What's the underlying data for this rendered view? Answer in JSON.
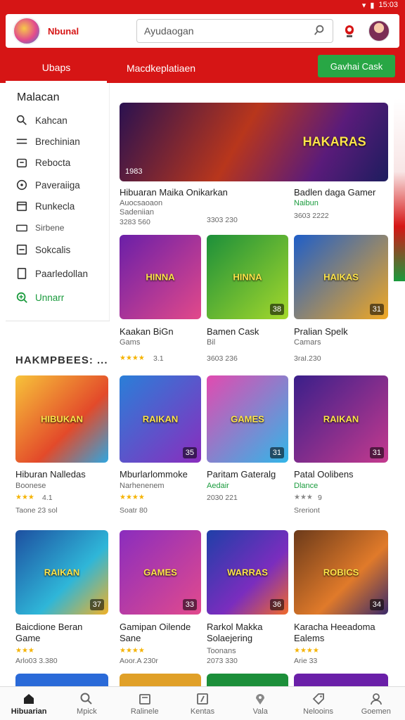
{
  "status": {
    "time": "15:03"
  },
  "header": {
    "brand": "Nbunal",
    "search_placeholder": "Ayudaogan"
  },
  "tabs": [
    {
      "label": "Ubaps"
    },
    {
      "label": "Macdkeplatiaen"
    }
  ],
  "cta": {
    "label": "Gavhai Cask"
  },
  "sidebar": {
    "title": "Malacan",
    "items": [
      {
        "label": "Kahcan",
        "icon": "search-icon"
      },
      {
        "label": "Brechinian",
        "icon": "list-icon"
      },
      {
        "label": "Rebocta",
        "icon": "bag-icon"
      },
      {
        "label": "Paveraiiga",
        "icon": "compass-icon"
      },
      {
        "label": "Runkecla",
        "icon": "folder-icon"
      },
      {
        "label": "Sirbene",
        "icon": "card-icon"
      },
      {
        "label": "Sokcalis",
        "icon": "minus-box-icon"
      },
      {
        "label": "Paarledollan",
        "icon": "document-icon"
      },
      {
        "label": "Unnarr",
        "icon": "search-plus-icon"
      }
    ]
  },
  "section": {
    "title": "HAKMPBEES: ..."
  },
  "featured": [
    {
      "title": "Hibuaran Maika Onikarkan",
      "sub1": "Auocsaoaon",
      "sub2": "Sadeniian",
      "meta": "3283 560",
      "badge": "1983"
    },
    {
      "meta": "3303 230"
    },
    {
      "title": "Badlen daga Gamer",
      "sub1": "Naibun",
      "meta": "3603 2222"
    }
  ],
  "grid": [
    {
      "title": "Kaakan BiGn",
      "sub": "Gams",
      "stars": "★★★★",
      "rating": "3.1",
      "meta": "",
      "badge": ""
    },
    {
      "title": "Bamen Cask",
      "sub": "Bil",
      "stars": "",
      "rating": "",
      "meta": "3603 236",
      "badge": "38"
    },
    {
      "title": "Pralian Spelk",
      "sub": "Camars",
      "stars": "",
      "rating": "",
      "meta": "3raI.230",
      "badge": "31"
    },
    {
      "title": "Hiburan Nalledas",
      "sub": "Boonese",
      "stars": "★★★",
      "rating": "4.1",
      "meta": "Taone 23 sol",
      "badge": ""
    },
    {
      "title": "Mburlarlommoke",
      "sub": "Narhenenem",
      "stars": "★★★★",
      "rating": "",
      "meta": "Soatr 80",
      "badge": "35"
    },
    {
      "title": "Paritam Gateralg",
      "sub": "Aedair",
      "stars": "",
      "rating": "",
      "meta": "2030 221",
      "badge": "31"
    },
    {
      "title": "Patal Oolibens",
      "sub": "Dlance",
      "stars": "★★★",
      "rating": "9",
      "meta": "Sreriont",
      "badge": "31"
    },
    {
      "title": "Baicdione Beran Game",
      "sub": "",
      "stars": "★★★",
      "rating": "",
      "meta": "Arlo03 3.380",
      "badge": "37"
    },
    {
      "title": "Gamipan Oilende Sane",
      "sub": "",
      "stars": "★★★★",
      "rating": "",
      "meta": "Aoor.A 230r",
      "badge": "33"
    },
    {
      "title": "Rarkol Makka Solaejering",
      "sub": "Toonans",
      "stars": "",
      "rating": "",
      "meta": "2073 330",
      "badge": "36"
    },
    {
      "title": "Karacha Heeadoma Ealems",
      "sub": "",
      "stars": "★★★★",
      "rating": "",
      "meta": "Arie 33",
      "badge": "34"
    }
  ],
  "tile_art": [
    "HAKARAS",
    "HINNA",
    "HAIKAS",
    "HIBUKAN",
    "RAIKAN",
    "GAMES",
    "WARRAS",
    "ROBICS"
  ],
  "bottom_nav": [
    {
      "label": "Hibuarian",
      "icon": "home-icon"
    },
    {
      "label": "Mpick",
      "icon": "search-icon"
    },
    {
      "label": "Ralinele",
      "icon": "inbox-icon"
    },
    {
      "label": "Kentas",
      "icon": "edit-icon"
    },
    {
      "label": "Vala",
      "icon": "pin-icon"
    },
    {
      "label": "Nelooins",
      "icon": "tag-icon"
    },
    {
      "label": "Goemen",
      "icon": "person-icon"
    }
  ],
  "colors": {
    "brand": "#d61515",
    "accent_green": "#28a745",
    "star": "#f5b301"
  }
}
